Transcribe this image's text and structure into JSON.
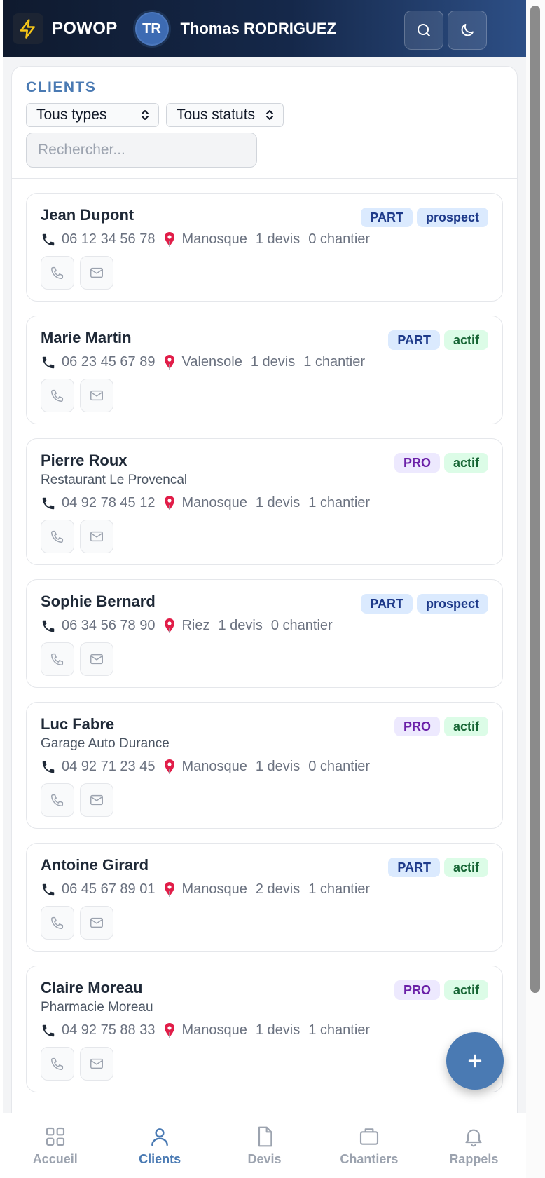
{
  "header": {
    "brand": "POWOP",
    "avatar_initials": "TR",
    "user_name": "Thomas RODRIGUEZ",
    "search_icon": "search-icon",
    "theme_icon": "moon-icon"
  },
  "filters": {
    "title": "CLIENTS",
    "type_select": "Tous types",
    "status_select": "Tous statuts",
    "search_placeholder": "Rechercher..."
  },
  "clients": [
    {
      "name": "Jean Dupont",
      "company": "",
      "type": "PART",
      "status": "prospect",
      "phone": "06 12 34 56 78",
      "city": "Manosque",
      "devis": "1 devis",
      "chantier": "0 chantier"
    },
    {
      "name": "Marie Martin",
      "company": "",
      "type": "PART",
      "status": "actif",
      "phone": "06 23 45 67 89",
      "city": "Valensole",
      "devis": "1 devis",
      "chantier": "1 chantier"
    },
    {
      "name": "Pierre Roux",
      "company": "Restaurant Le Provencal",
      "type": "PRO",
      "status": "actif",
      "phone": "04 92 78 45 12",
      "city": "Manosque",
      "devis": "1 devis",
      "chantier": "1 chantier"
    },
    {
      "name": "Sophie Bernard",
      "company": "",
      "type": "PART",
      "status": "prospect",
      "phone": "06 34 56 78 90",
      "city": "Riez",
      "devis": "1 devis",
      "chantier": "0 chantier"
    },
    {
      "name": "Luc Fabre",
      "company": "Garage Auto Durance",
      "type": "PRO",
      "status": "actif",
      "phone": "04 92 71 23 45",
      "city": "Manosque",
      "devis": "1 devis",
      "chantier": "0 chantier"
    },
    {
      "name": "Antoine Girard",
      "company": "",
      "type": "PART",
      "status": "actif",
      "phone": "06 45 67 89 01",
      "city": "Manosque",
      "devis": "2 devis",
      "chantier": "1 chantier"
    },
    {
      "name": "Claire Moreau",
      "company": "Pharmacie Moreau",
      "type": "PRO",
      "status": "actif",
      "phone": "04 92 75 88 33",
      "city": "Manosque",
      "devis": "1 devis",
      "chantier": "1 chantier"
    }
  ],
  "fab_icon": "plus-icon",
  "nav": [
    {
      "label": "Accueil",
      "icon": "grid-icon"
    },
    {
      "label": "Clients",
      "icon": "user-icon"
    },
    {
      "label": "Devis",
      "icon": "document-icon"
    },
    {
      "label": "Chantiers",
      "icon": "briefcase-icon"
    },
    {
      "label": "Rappels",
      "icon": "bell-icon"
    }
  ],
  "colors": {
    "accent": "#4a7ab3",
    "header_dark": "#0f1a2e",
    "header_light": "#2d4f86",
    "part_badge": "#dbeafe",
    "pro_badge": "#ede9fe",
    "actif_badge": "#dcfce7"
  }
}
